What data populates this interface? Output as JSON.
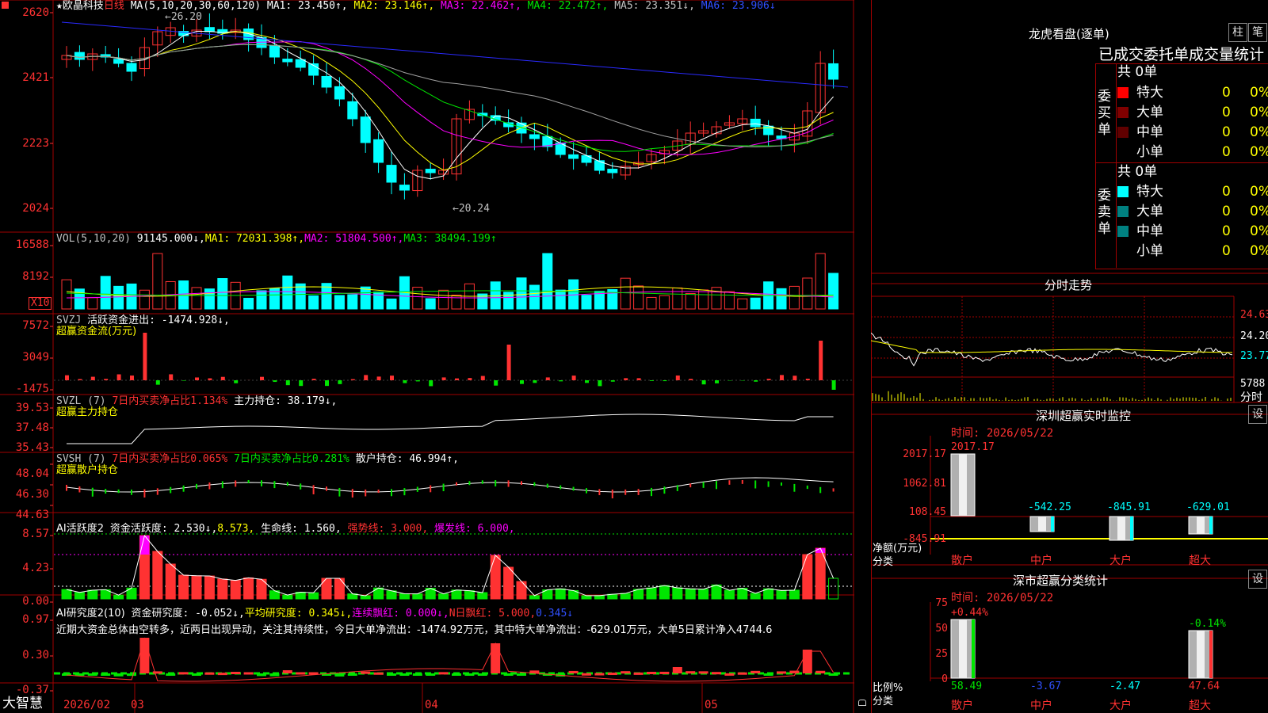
{
  "colors": {
    "bg": "#000000",
    "grid": "#a00000",
    "up": "#ff3232",
    "down": "#00ffff",
    "ma1": "#ffffff",
    "ma2": "#ffff00",
    "ma3": "#ff00ff",
    "ma4": "#00e600",
    "ma5": "#a0a0a0",
    "ma6": "#2a2aff"
  },
  "stock": {
    "star": "★",
    "name": "欧晶科技",
    "period": "日线"
  },
  "main_panel": {
    "ma_params": "MA(5,10,20,30,60,120)",
    "ma1": "MA1: 23.450↑,",
    "ma2": "MA2: 23.146↑,",
    "ma3": "MA3: 22.462↑,",
    "ma4": "MA4: 22.472↑,",
    "ma5": "MA5: 23.351↓,",
    "ma6": "MA6: 23.906↓",
    "high_mark": "←26.20",
    "low_mark": "←20.24",
    "y_ticks": [
      "2620",
      "2421",
      "2223",
      "2024"
    ]
  },
  "vol_panel": {
    "title": "VOL(5,10,20)",
    "vol": "91145.000↓,",
    "ma1": "MA1: 72031.398↑,",
    "ma2": "MA2: 51804.500↑,",
    "ma3": "MA3: 38494.199↑",
    "y_ticks": [
      "16588",
      "8192"
    ],
    "unit": "X10"
  },
  "svzj_panel": {
    "title": "SVZJ",
    "text": "活跃资金进出: -1474.928↓,",
    "subtitle": "超赢资金流(万元)",
    "y_ticks": [
      "7572",
      "3049",
      "-1475"
    ]
  },
  "svzl_panel": {
    "title": "SVZL (7)",
    "ratio": "7日内买卖净占比1.134%",
    "hold": "主力持仓: 38.179↓,",
    "subtitle": "超赢主力持仓",
    "y_ticks": [
      "39.53",
      "37.48",
      "35.43"
    ]
  },
  "svsh_panel": {
    "title": "SVSH (7)",
    "ratio": "7日内买卖净占比0.065%",
    "ratio2": "7日内买卖净占比0.281%",
    "hold": "散户持仓: 46.994↑,",
    "subtitle": "超赢散户持仓",
    "y_ticks": [
      "48.04",
      "46.30",
      "44.63"
    ]
  },
  "ai_active_panel": {
    "title": "AI活跃度2",
    "val1": "资金活跃度: 2.530↓,",
    "val2": "8.573,",
    "val3": "生命线: 1.560,",
    "val4": "强势线: 3.000,",
    "val5": "爆发线: 6.000,",
    "y_ticks": [
      "8.57",
      "4.23",
      "0.00"
    ]
  },
  "ai_research_panel": {
    "title": "AI研究度2(10)",
    "val1": "资金研究度: -0.052↓,",
    "val2": "平均研究度: 0.345↓,",
    "val3": "连续飘红: 0.000↓,",
    "val4": "N日飘红: 5.000,",
    "val5": "0.345↓",
    "comment": "近期大资金总体由空转多，近两日出现异动，关注其持续性，今日大单净流出：-1474.92万元，其中特大单净流出：-629.01万元，大单5日累计净入4744.6",
    "y_ticks": [
      "0.97",
      "0.30",
      "-0.37"
    ]
  },
  "x_axis": {
    "brand": "大智慧",
    "labels": [
      "2026/02",
      "03",
      "04",
      "05"
    ]
  },
  "dragon_tiger": {
    "title": "龙虎看盘(逐单)",
    "btn1": "柱",
    "btn2": "笔",
    "subtitle": "已成交委托单成交量统计",
    "buy_label": "委买单",
    "sell_label": "委卖单",
    "buy_total": "共 0单",
    "sell_total": "共 0单",
    "buy_rows": [
      {
        "name": "特大",
        "count": "0",
        "pct": "0%",
        "color": "#ff0000"
      },
      {
        "name": "大单",
        "count": "0",
        "pct": "0%",
        "color": "#800000"
      },
      {
        "name": "中单",
        "count": "0",
        "pct": "0%",
        "color": "#600000"
      },
      {
        "name": "小单",
        "count": "0",
        "pct": "0%",
        "color": "#000000"
      }
    ],
    "sell_rows": [
      {
        "name": "特大",
        "count": "0",
        "pct": "0%",
        "color": "#00ffff"
      },
      {
        "name": "大单",
        "count": "0",
        "pct": "0%",
        "color": "#008080"
      },
      {
        "name": "中单",
        "count": "0",
        "pct": "0%",
        "color": "#008080"
      },
      {
        "name": "小单",
        "count": "0",
        "pct": "0%",
        "color": "#000000"
      }
    ]
  },
  "intraday": {
    "title": "分时走势",
    "prices": [
      "24.63",
      "24.20",
      "23.77"
    ],
    "vol": "5788",
    "vol_unit": "分时"
  },
  "sz_monitor": {
    "title": "深圳超赢实时监控",
    "btn": "设",
    "time": "时间: 2026/05/22",
    "top_label": "2017.17",
    "y_ticks": [
      "2017.17",
      "1062.81",
      "108.45",
      "-845.91"
    ],
    "unit": "净额(万元)",
    "cat_label": "分类",
    "values": [
      "-542.25",
      "-845.91",
      "-629.01"
    ],
    "categories": [
      "散户",
      "中户",
      "大户",
      "超大"
    ]
  },
  "sz_stats": {
    "title": "深市超赢分类统计",
    "btn": "设",
    "time": "时间: 2026/05/22",
    "y_ticks": [
      "75",
      "50",
      "25",
      "0"
    ],
    "unit": "比例%",
    "cat_label": "分类",
    "top_values": [
      "+0.44%",
      "-0.14%"
    ],
    "bottom_values": [
      "58.49",
      "-3.67",
      "-2.47",
      "47.64"
    ],
    "categories": [
      "散户",
      "中户",
      "大户",
      "超大"
    ]
  }
}
